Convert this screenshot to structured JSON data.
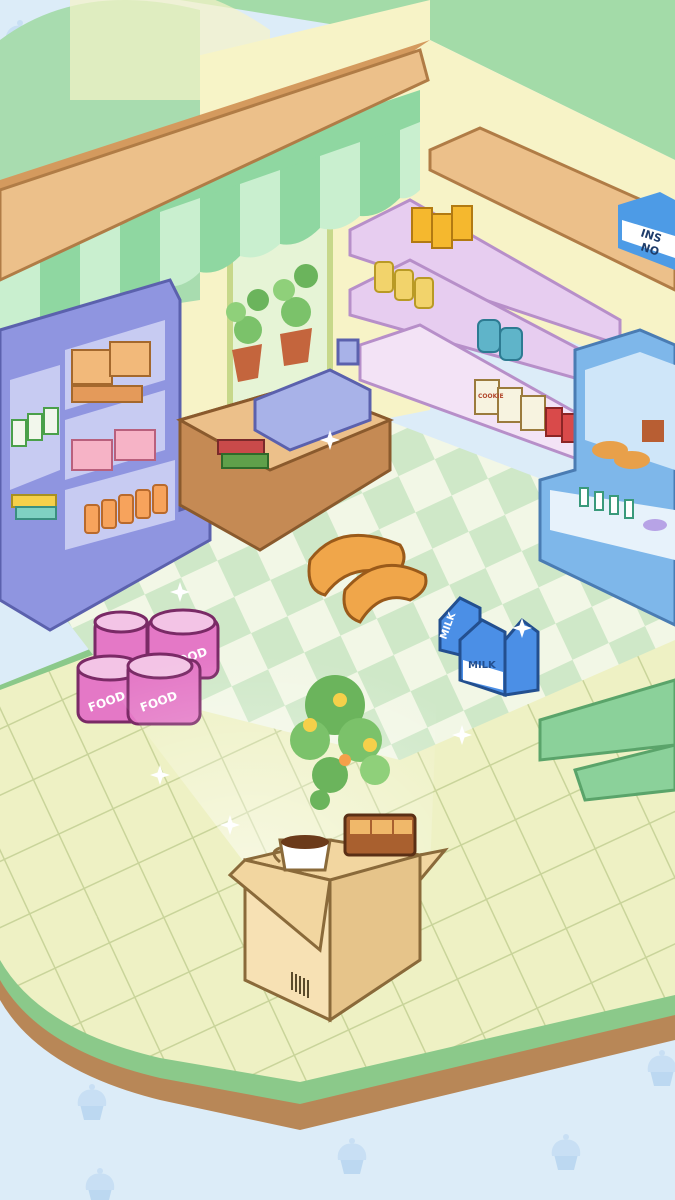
{
  "labels": {
    "milk": "MILK",
    "food": "FOOD",
    "cookie": "COOKIE",
    "box_sign_line1": "INS",
    "box_sign_line2": "NO"
  },
  "colors": {
    "background": "#dcecf8",
    "floor": "#eef1c4",
    "floor_tile_line": "#c9d49a",
    "floor_border": "#8bc98a",
    "floor_base": "#b88757",
    "checker_light": "#f2f7e6",
    "checker_dark": "#cfe8c8",
    "awning": "#8fd7a1",
    "awning_stripe": "#c9efcf",
    "wood": "#ecc08a",
    "shelf_purple": "#8f95e0",
    "shelf_pink": "#e7cdf0",
    "fridge_blue": "#7eb7ea",
    "milk_blue": "#4b8fe6",
    "food_can_pink": "#e478c6",
    "cardboard": "#f2d6a0"
  },
  "icons": {
    "background_pattern": "cupcake-icon",
    "sparkle": "sparkle-icon"
  }
}
